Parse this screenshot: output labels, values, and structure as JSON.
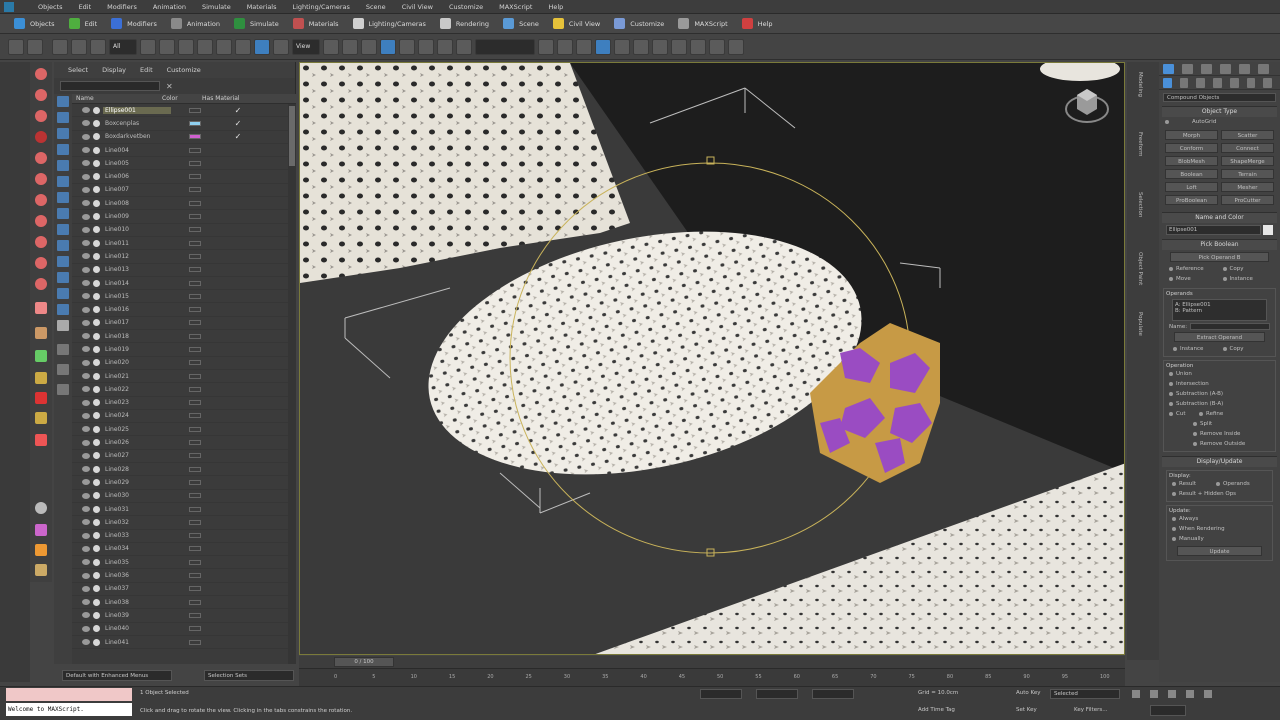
{
  "menu": [
    "Objects",
    "Edit",
    "Modifiers",
    "Animation",
    "Simulate",
    "Materials",
    "Lighting/Cameras",
    "Scene",
    "Civil View",
    "Customize",
    "MAXScript",
    "Help"
  ],
  "ribbon": [
    {
      "label": "Objects",
      "color": "#3b8fd6"
    },
    {
      "label": "Edit",
      "color": "#4fae3f"
    },
    {
      "label": "Modifiers",
      "color": "#3b6fd6"
    },
    {
      "label": "Animation",
      "color": "#8a8a8a"
    },
    {
      "label": "Simulate",
      "color": "#2f8f3f"
    },
    {
      "label": "Materials",
      "color": "#c05050"
    },
    {
      "label": "Lighting/Cameras",
      "color": "#d0d0d0"
    },
    {
      "label": "Rendering",
      "color": "#c9c9c9"
    },
    {
      "label": "Scene",
      "color": "#5a9ad6"
    },
    {
      "label": "Civil View",
      "color": "#e6c23a"
    },
    {
      "label": "Customize",
      "color": "#7a9ad6"
    },
    {
      "label": "MAXScript",
      "color": "#9a9a9a"
    },
    {
      "label": "Help",
      "color": "#d04040"
    }
  ],
  "toolbar": {
    "selection_filter": "All",
    "view_dropdown": "View"
  },
  "explorer": {
    "menu": [
      "Select",
      "Display",
      "Edit",
      "Customize"
    ],
    "columns": {
      "name": "Name",
      "color": "Color",
      "has_material": "Has Material"
    },
    "rows": [
      {
        "name": "Ellipse001",
        "color": "#3a3a3a",
        "checked": true,
        "selected": true
      },
      {
        "name": "Boxcenplas",
        "color": "#8fd0f0",
        "checked": true
      },
      {
        "name": "Boxdarkvetben",
        "color": "#d060d0",
        "checked": true
      },
      {
        "name": "Line004"
      },
      {
        "name": "Line005"
      },
      {
        "name": "Line006"
      },
      {
        "name": "Line007"
      },
      {
        "name": "Line008"
      },
      {
        "name": "Line009"
      },
      {
        "name": "Line010"
      },
      {
        "name": "Line011"
      },
      {
        "name": "Line012"
      },
      {
        "name": "Line013"
      },
      {
        "name": "Line014"
      },
      {
        "name": "Line015"
      },
      {
        "name": "Line016"
      },
      {
        "name": "Line017"
      },
      {
        "name": "Line018"
      },
      {
        "name": "Line019"
      },
      {
        "name": "Line020"
      },
      {
        "name": "Line021"
      },
      {
        "name": "Line022"
      },
      {
        "name": "Line023"
      },
      {
        "name": "Line024"
      },
      {
        "name": "Line025"
      },
      {
        "name": "Line026"
      },
      {
        "name": "Line027"
      },
      {
        "name": "Line028"
      },
      {
        "name": "Line029"
      },
      {
        "name": "Line030"
      },
      {
        "name": "Line031"
      },
      {
        "name": "Line032"
      },
      {
        "name": "Line033"
      },
      {
        "name": "Line034"
      },
      {
        "name": "Line035"
      },
      {
        "name": "Line036"
      },
      {
        "name": "Line037"
      },
      {
        "name": "Line038"
      },
      {
        "name": "Line039"
      },
      {
        "name": "Line040"
      },
      {
        "name": "Line041"
      }
    ]
  },
  "command_panel": {
    "category": "Compound Objects",
    "object_type_title": "Object Type",
    "autogrid": "AutoGrid",
    "buttons": [
      "Morph",
      "Scatter",
      "Conform",
      "Connect",
      "BlobMesh",
      "ShapeMerge",
      "Boolean",
      "Terrain",
      "Loft",
      "Mesher",
      "ProBoolean",
      "ProCutter"
    ],
    "name_color_title": "Name and Color",
    "object_name": "Ellipse001",
    "pick_boolean_title": "Pick Boolean",
    "pick_operand_button": "Pick Operand B",
    "pick_options": [
      "Reference",
      "Copy",
      "Move",
      "Instance"
    ],
    "operands_title": "Operands",
    "operands": [
      "A: Ellipse001",
      "B: Pattern"
    ],
    "name_label": "Name:",
    "extract_operand": "Extract Operand",
    "extract_options": [
      "Instance",
      "Copy"
    ],
    "operation_title": "Operation",
    "operations": [
      "Union",
      "Intersection",
      "Subtraction (A-B)",
      "Subtraction (B-A)",
      "Cut"
    ],
    "cut_options": [
      "Refine",
      "Split",
      "Remove Inside",
      "Remove Outside"
    ],
    "display_update_title": "Display/Update",
    "display_label": "Display:",
    "display_options": [
      "Result",
      "Operands",
      "Result + Hidden Ops"
    ],
    "update_label": "Update:",
    "update_options": [
      "Always",
      "When Rendering",
      "Manually"
    ],
    "update_button": "Update"
  },
  "side_tabs": [
    "Modeling",
    "Freeform",
    "Selection",
    "Object Paint",
    "Populate"
  ],
  "timeline": {
    "frame_label": "0 / 100",
    "ticks": [
      0,
      5,
      10,
      15,
      20,
      25,
      30,
      35,
      40,
      45,
      50,
      55,
      60,
      65,
      70,
      75,
      80,
      85,
      90,
      95,
      100
    ]
  },
  "status": {
    "workspace": "Default with Enhanced Menus",
    "selection_set": "Selection Sets",
    "objects_selected": "1 Object Selected",
    "prompt": "Click and drag to rotate the view.  Clicking in the tabs constrains the rotation.",
    "listener_text": "Welcome to MAXScript.",
    "grid": "Grid = 10.0cm",
    "add_time_tag": "Add Time Tag",
    "auto_key": "Auto Key",
    "set_key": "Set Key",
    "selected": "Selected",
    "key_filters": "Key Filters..."
  },
  "accent_color": "#3e7fbf"
}
